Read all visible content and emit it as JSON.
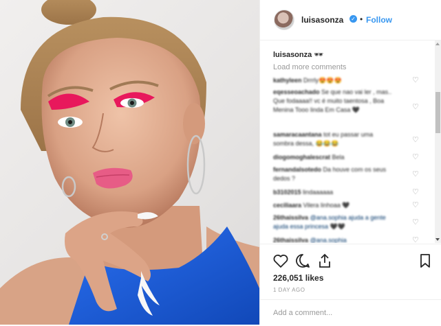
{
  "post": {
    "username": "luisasonza",
    "verified_mark": "✓",
    "separator": "•",
    "follow_label": "Follow"
  },
  "caption": {
    "username": "luisasonza",
    "emoji": "🕶"
  },
  "load_more_label": "Load more comments",
  "comments": [
    {
      "user": "kathyleen",
      "text": "Drrrly😍😍😍"
    },
    {
      "user": "eqesseoachado",
      "text": "Se que nao vai ler , mas.. Que fodaaaa!! vc é muito taentosa , Boa Menina Tooo linda Em Casa 🖤"
    },
    {
      "user": "samaracaantana",
      "text": "tot eu passar uma sombra dessa, 😂😂😂"
    },
    {
      "user": "diogomoghalescrat",
      "text": "Bela"
    },
    {
      "user": "fernandalsotedo",
      "text": "Da houve com os seus dedos ?"
    },
    {
      "user": "b3102015",
      "text": "lindaaaaaa"
    },
    {
      "user": "ceciliaara",
      "text": "Vilera linhoaa 🖤"
    },
    {
      "user": "26thaissilva",
      "text": "@ana.sophia ajuda a gente ajuda essa princesa 🖤🖤"
    },
    {
      "user": "26thaissilva",
      "text": "@ana.sophia"
    }
  ],
  "actions": {
    "like_icon": "heart-icon",
    "comment_icon": "comment-icon",
    "share_icon": "share-icon",
    "save_icon": "bookmark-icon"
  },
  "likes_text": "226,051 likes",
  "time_ago": "1 DAY AGO",
  "comment_placeholder": "Add a comment...",
  "colors": {
    "link_blue": "#3897f0",
    "top_blue": "#1c5fd8",
    "lip_pink": "#e75c86",
    "eyeshadow_pink": "#e8185c"
  }
}
